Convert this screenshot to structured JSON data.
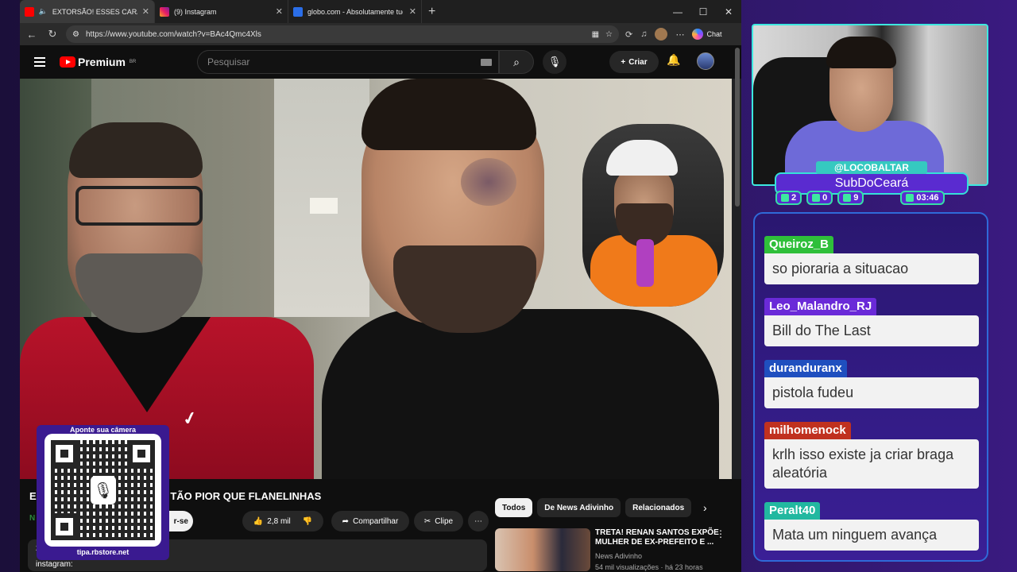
{
  "browser": {
    "tabs": [
      {
        "label": "EXTORSÃO! ESSES CARAS TÃO",
        "active": true
      },
      {
        "label": "(9) Instagram",
        "active": false
      },
      {
        "label": "globo.com - Absolutamente tudo",
        "active": false
      }
    ],
    "url": "https://www.youtube.com/watch?v=BAc4Qmc4Xls",
    "chat_label": "Chat"
  },
  "youtube": {
    "logo": "Premium",
    "region": "BR",
    "search_placeholder": "Pesquisar",
    "create_label": "Criar",
    "video_title_start": "EX",
    "video_title_end": "TÃO PIOR QUE FLANELINHAS",
    "channel_initial": "N",
    "subscribe_tail": "r-se",
    "likes": "2,8 mil",
    "share_label": "Compartilhar",
    "clip_label": "Clipe",
    "desc_line1": "2",
    "desc_line2": "instagram:",
    "chips": [
      "Todos",
      "De News Adivinho",
      "Relacionados"
    ],
    "reco": {
      "title": "TRETA! RENAN SANTOS EXPÕE MULHER DE EX-PREFEITO E ...",
      "channel": "News Adivinho",
      "meta": "54 mil visualizações · há 23 horas"
    }
  },
  "qr": {
    "top": "Aponte sua câmera",
    "bottom": "tipa.rbstore.net"
  },
  "stream": {
    "handle": "@LOCOBALTAR",
    "sub_name": "SubDoCeará",
    "stats": [
      {
        "icon": "chat-icon",
        "value": "2"
      },
      {
        "icon": "youtube-icon",
        "value": "0"
      },
      {
        "icon": "like-icon",
        "value": "9"
      },
      {
        "icon": "whatsapp-icon",
        "value": "03:46"
      }
    ],
    "colors": {
      "accent": "#35e0d8",
      "panel": "#5a2bd0"
    }
  },
  "chat": [
    {
      "user": "Queiroz_B",
      "color": "#2fbf3a",
      "text": "so pioraria a situacao"
    },
    {
      "user": "Leo_Malandro_RJ",
      "color": "#6a2ad8",
      "text": "Bill do The Last"
    },
    {
      "user": "duranduranx",
      "color": "#1f4fbf",
      "text": "pistola fudeu"
    },
    {
      "user": "milhomenock",
      "color": "#c0311f",
      "text": "krlh isso existe ja criar braga aleatória"
    },
    {
      "user": "Peralt40",
      "color": "#22b8a0",
      "text": "Mata um ninguem avança"
    }
  ]
}
